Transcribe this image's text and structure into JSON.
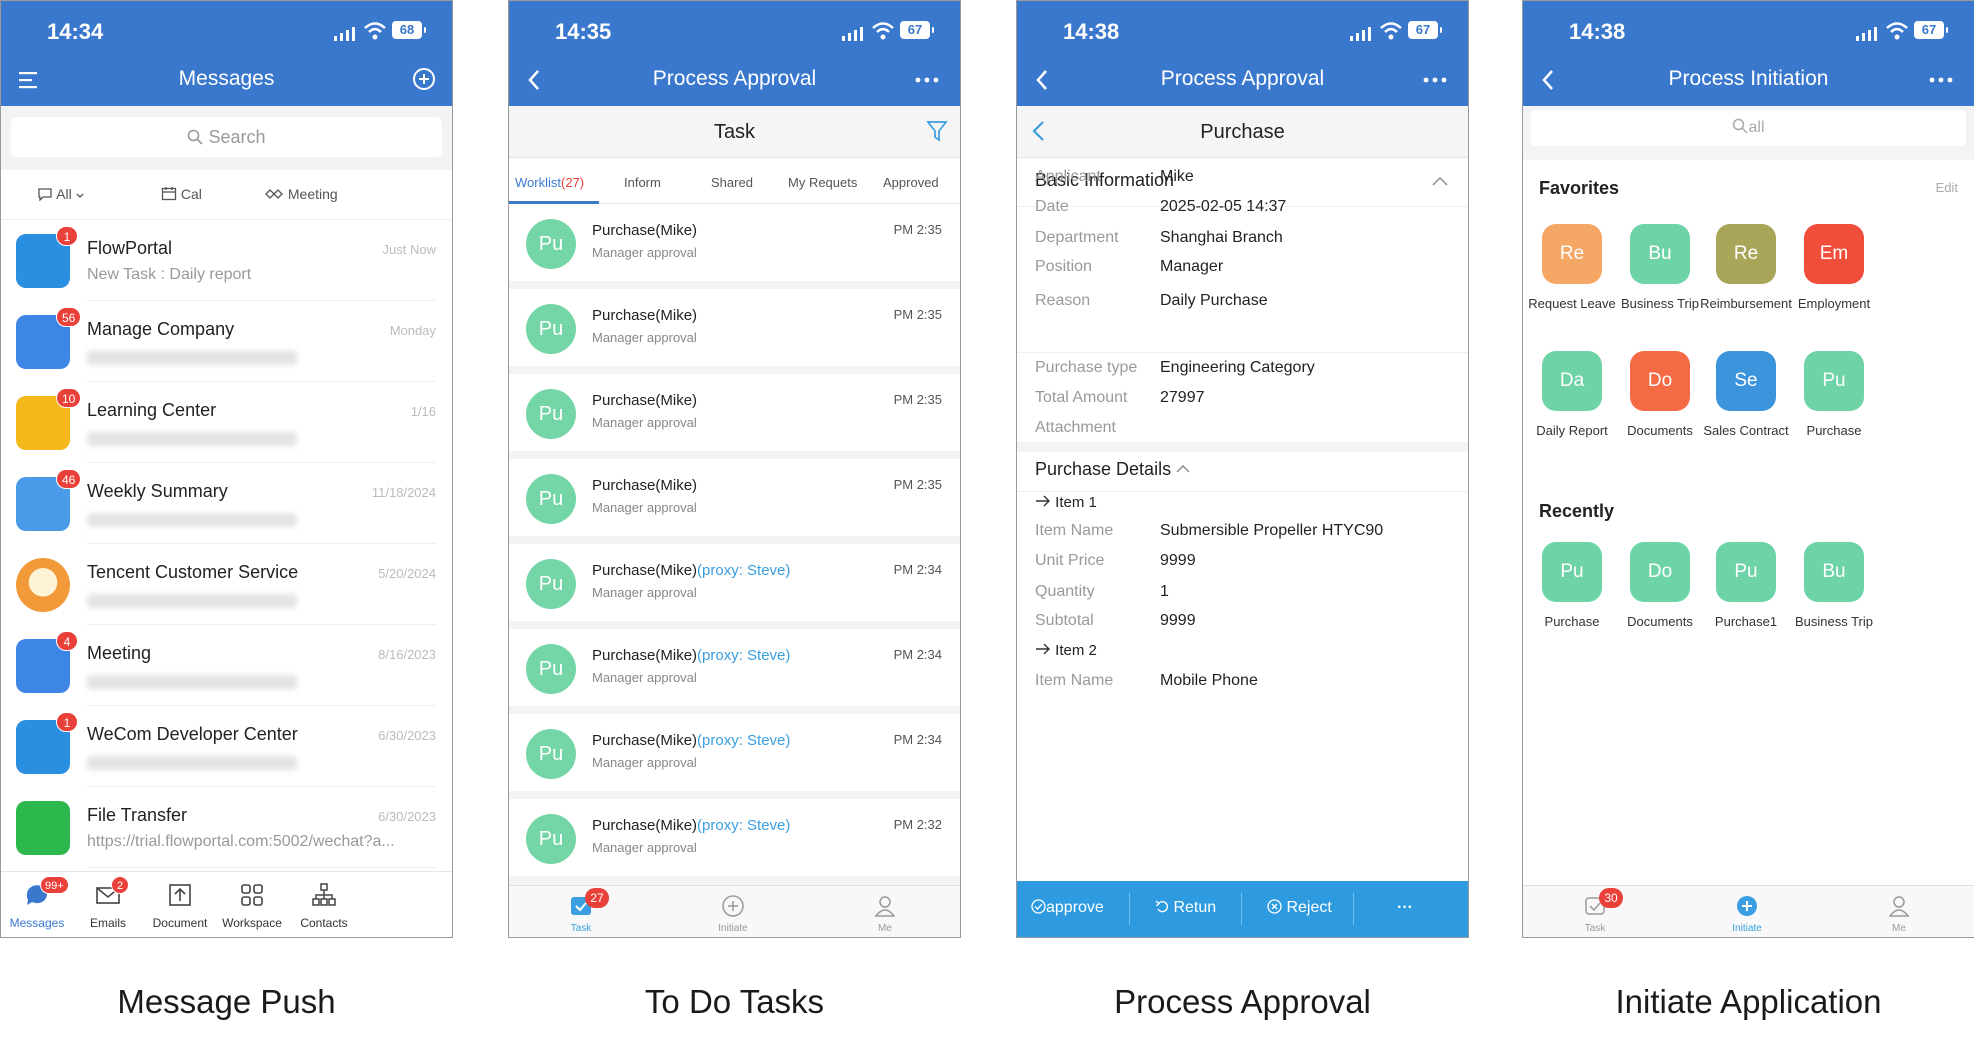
{
  "panels": {
    "p1": {
      "time": "14:34",
      "battery": "68",
      "title": "Messages",
      "search_placeholder": "Search",
      "filters": [
        "All",
        "Cal",
        "Meeting"
      ],
      "messages": [
        {
          "name": "FlowPortal",
          "sub": "New Task : Daily report",
          "time": "Just Now",
          "badge": "1",
          "icon_color": "#2a8fe0",
          "icon": "flowportal-icon"
        },
        {
          "name": "Manage Company",
          "sub": "",
          "time": "Monday",
          "badge": "56",
          "icon_color": "#3e86e6",
          "icon": "manage-company-icon"
        },
        {
          "name": "Learning Center",
          "sub": "",
          "time": "1/16",
          "badge": "10",
          "icon_color": "#f5b81b",
          "icon": "learning-center-icon"
        },
        {
          "name": "Weekly Summary",
          "sub": "",
          "time": "11/18/2024",
          "badge": "46",
          "icon_color": "#4a9be8",
          "icon": "weekly-summary-icon"
        },
        {
          "name": "Tencent Customer Service",
          "sub": "",
          "time": "5/20/2024",
          "badge": "",
          "icon_color": "#f29a3a",
          "icon": "customer-service-icon"
        },
        {
          "name": "Meeting",
          "sub": "",
          "time": "8/16/2023",
          "badge": "4",
          "icon_color": "#3e86e6",
          "icon": "meeting-icon"
        },
        {
          "name": "WeCom Developer Center",
          "sub": "",
          "time": "6/30/2023",
          "badge": "1",
          "icon_color": "#2a8fe0",
          "icon": "developer-center-icon"
        },
        {
          "name": "File Transfer",
          "sub": "https://trial.flowportal.com:5002/wechat?a...",
          "time": "6/30/2023",
          "badge": "",
          "icon_color": "#2db84d",
          "icon": "file-transfer-icon"
        }
      ],
      "tabs": [
        {
          "label": "Messages",
          "badge": "99+"
        },
        {
          "label": "Emails",
          "badge": "2"
        },
        {
          "label": "Document",
          "badge": ""
        },
        {
          "label": "Workspace",
          "badge": ""
        },
        {
          "label": "Contacts",
          "badge": ""
        }
      ],
      "caption": "Message Push"
    },
    "p2": {
      "time": "14:35",
      "battery": "67",
      "title": "Process Approval",
      "subtitle": "Task",
      "tabs": {
        "worklist": "Worklist",
        "worklist_count": "(27)",
        "inform": "Inform",
        "shared": "Shared",
        "requests": "My Requets",
        "approved": "Approved"
      },
      "tasks": [
        {
          "avatar": "Pu",
          "name": "Purchase(Mike)",
          "proxy": "",
          "step": "Manager approval",
          "time": "PM 2:35"
        },
        {
          "avatar": "Pu",
          "name": "Purchase(Mike)",
          "proxy": "",
          "step": "Manager approval",
          "time": "PM 2:35"
        },
        {
          "avatar": "Pu",
          "name": "Purchase(Mike)",
          "proxy": "",
          "step": "Manager approval",
          "time": "PM 2:35"
        },
        {
          "avatar": "Pu",
          "name": "Purchase(Mike)",
          "proxy": "",
          "step": "Manager approval",
          "time": "PM 2:35"
        },
        {
          "avatar": "Pu",
          "name": "Purchase(Mike)",
          "proxy": "(proxy: Steve)",
          "step": "Manager approval",
          "time": "PM 2:34"
        },
        {
          "avatar": "Pu",
          "name": "Purchase(Mike)",
          "proxy": "(proxy: Steve)",
          "step": "Manager approval",
          "time": "PM 2:34"
        },
        {
          "avatar": "Pu",
          "name": "Purchase(Mike)",
          "proxy": "(proxy: Steve)",
          "step": "Manager approval",
          "time": "PM 2:34"
        },
        {
          "avatar": "Pu",
          "name": "Purchase(Mike)",
          "proxy": "(proxy: Steve)",
          "step": "Manager approval",
          "time": "PM 2:32"
        }
      ],
      "tabbar": {
        "task": "Task",
        "task_badge": "27",
        "initiate": "Initiate",
        "me": "Me"
      },
      "caption": "To Do Tasks"
    },
    "p3": {
      "time": "14:38",
      "battery": "67",
      "title": "Process Approval",
      "subtitle": "Purchase",
      "basic_title": "Basic Information",
      "basic": [
        {
          "k": "Applicant",
          "v": "Mike"
        },
        {
          "k": "Date",
          "v": "2025-02-05 14:37"
        },
        {
          "k": "Department",
          "v": "Shanghai Branch"
        },
        {
          "k": "Position",
          "v": "Manager"
        },
        {
          "k": "Reason",
          "v": "Daily Purchase"
        }
      ],
      "extra": [
        {
          "k": "Purchase type",
          "v": "Engineering Category"
        },
        {
          "k": "Total Amount",
          "v": "27997"
        },
        {
          "k": "Attachment",
          "v": ""
        }
      ],
      "details_title": "Purchase Details",
      "item1": "Item 1",
      "item1_rows": [
        {
          "k": "Item Name",
          "v": "Submersible Propeller HTYC90"
        },
        {
          "k": "Unit Price",
          "v": "9999"
        },
        {
          "k": "Quantity",
          "v": "1"
        },
        {
          "k": "Subtotal",
          "v": "9999"
        }
      ],
      "item2": "Item 2",
      "item2_rows": [
        {
          "k": "Item Name",
          "v": "Mobile Phone"
        }
      ],
      "actions": {
        "approve": "approve",
        "return": "Retun",
        "reject": "Reject",
        "more": "···"
      },
      "caption": "Process Approval"
    },
    "p4": {
      "time": "14:38",
      "battery": "67",
      "title": "Process Initiation",
      "search_placeholder": "all",
      "favorites_title": "Favorites",
      "edit": "Edit",
      "favorites": [
        {
          "abbr": "Re",
          "label": "Request Leave",
          "color": "#f5a866"
        },
        {
          "abbr": "Bu",
          "label": "Business Trip",
          "color": "#6fd3a8"
        },
        {
          "abbr": "Re",
          "label": "Reimbursement",
          "color": "#a9a65a"
        },
        {
          "abbr": "Em",
          "label": "Employment",
          "color": "#f04e3a"
        },
        {
          "abbr": "Da",
          "label": "Daily Report",
          "color": "#6fd3a8"
        },
        {
          "abbr": "Do",
          "label": "Documents",
          "color": "#f36a45"
        },
        {
          "abbr": "Se",
          "label": "Sales Contract",
          "color": "#3c95dc"
        },
        {
          "abbr": "Pu",
          "label": "Purchase",
          "color": "#6fd3a8"
        }
      ],
      "recent_title": "Recently",
      "recent": [
        {
          "abbr": "Pu",
          "label": "Purchase",
          "color": "#6fd3a8"
        },
        {
          "abbr": "Do",
          "label": "Documents",
          "color": "#6fd3a8"
        },
        {
          "abbr": "Pu",
          "label": "Purchase1",
          "color": "#6fd3a8"
        },
        {
          "abbr": "Bu",
          "label": "Business Trip",
          "color": "#6fd3a8"
        }
      ],
      "tabbar": {
        "task": "Task",
        "task_badge": "30",
        "initiate": "Initiate",
        "me": "Me"
      },
      "caption": "Initiate Application"
    }
  }
}
